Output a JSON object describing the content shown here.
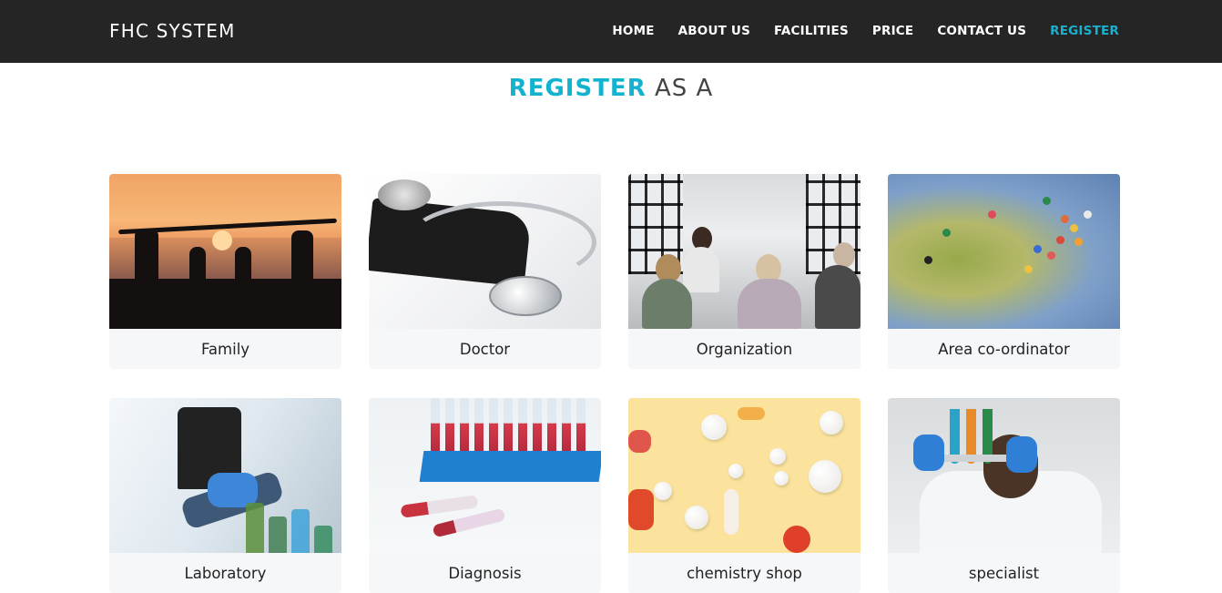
{
  "brand": "FHC SYSTEM",
  "nav": [
    {
      "label": "HOME"
    },
    {
      "label": "ABOUT US"
    },
    {
      "label": "FACILITIES"
    },
    {
      "label": "PRICE"
    },
    {
      "label": "CONTACT US"
    },
    {
      "label": "REGISTER",
      "active": true
    }
  ],
  "heading": {
    "accent": "REGISTER",
    "rest": " AS A"
  },
  "cards": [
    {
      "label": "Family"
    },
    {
      "label": "Doctor"
    },
    {
      "label": "Organization"
    },
    {
      "label": "Area co-ordinator"
    },
    {
      "label": "Laboratory"
    },
    {
      "label": "Diagnosis"
    },
    {
      "label": "chemistry shop"
    },
    {
      "label": "specialist"
    }
  ],
  "colors": {
    "navbar": "#252525",
    "accent": "#13b3cf",
    "card_bg": "#f6f7f9"
  }
}
